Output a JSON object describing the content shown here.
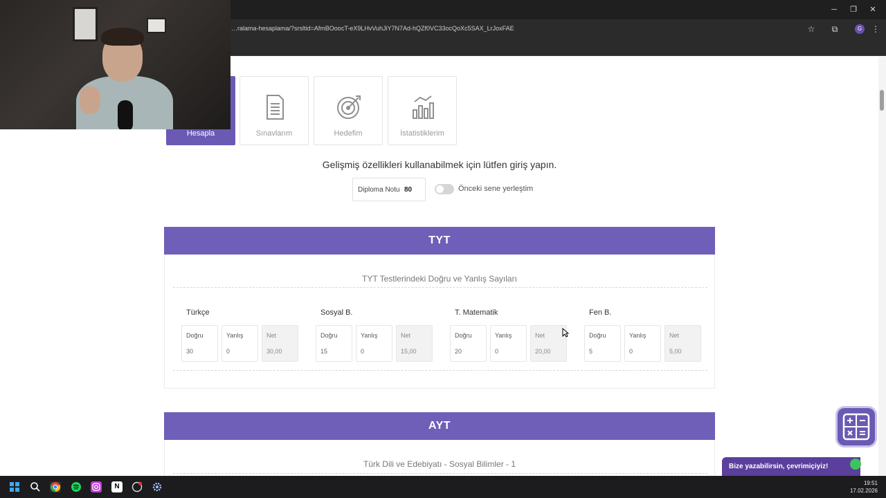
{
  "browser": {
    "url": "…ralama-hesaplama/?srsltid=AfmBOoocT-eX9LHvVuhJiY7N7Ad-hQZf0VC33ocQoXc5SAX_LrJoxFAE",
    "profile_initial": "G"
  },
  "tabs": [
    {
      "label": "Hesapla",
      "icon": "calculator-icon",
      "active": true
    },
    {
      "label": "Sınavlarım",
      "icon": "document-icon",
      "active": false
    },
    {
      "label": "Hedefim",
      "icon": "target-icon",
      "active": false
    },
    {
      "label": "İstatistiklerim",
      "icon": "chart-icon",
      "active": false
    }
  ],
  "login_message": "Gelişmiş özellikleri kullanabilmek için lütfen giriş yapın.",
  "diploma": {
    "label": "Diploma Notu",
    "value": "80"
  },
  "previous_year": {
    "label": "Önceki sene yerleştim",
    "on": false
  },
  "tyt": {
    "title": "TYT",
    "subtitle": "TYT Testlerindeki Doğru ve Yanlış Sayıları",
    "field_labels": {
      "correct": "Doğru",
      "wrong": "Yanlış",
      "net": "Net"
    },
    "subjects": [
      {
        "name": "Türkçe",
        "correct": "30",
        "wrong": "0",
        "net": "30,00"
      },
      {
        "name": "Sosyal B.",
        "correct": "15",
        "wrong": "0",
        "net": "15,00"
      },
      {
        "name": "T. Matematik",
        "correct": "20",
        "wrong": "0",
        "net": "20,00"
      },
      {
        "name": "Fen B.",
        "correct": "5",
        "wrong": "0",
        "net": "5,00"
      }
    ]
  },
  "ayt": {
    "title": "AYT",
    "subtitle": "Türk Dili ve Edebiyatı - Sosyal Bilimler - 1"
  },
  "chat": {
    "label": "Bize yazabilirsin, çevrimiçiyiz!"
  },
  "taskbar": {
    "time": "19:51",
    "date": "17.02.2026"
  },
  "colors": {
    "accent": "#6f5fb8",
    "active_tab": "#6a5ab3",
    "online": "#3fc35f"
  }
}
